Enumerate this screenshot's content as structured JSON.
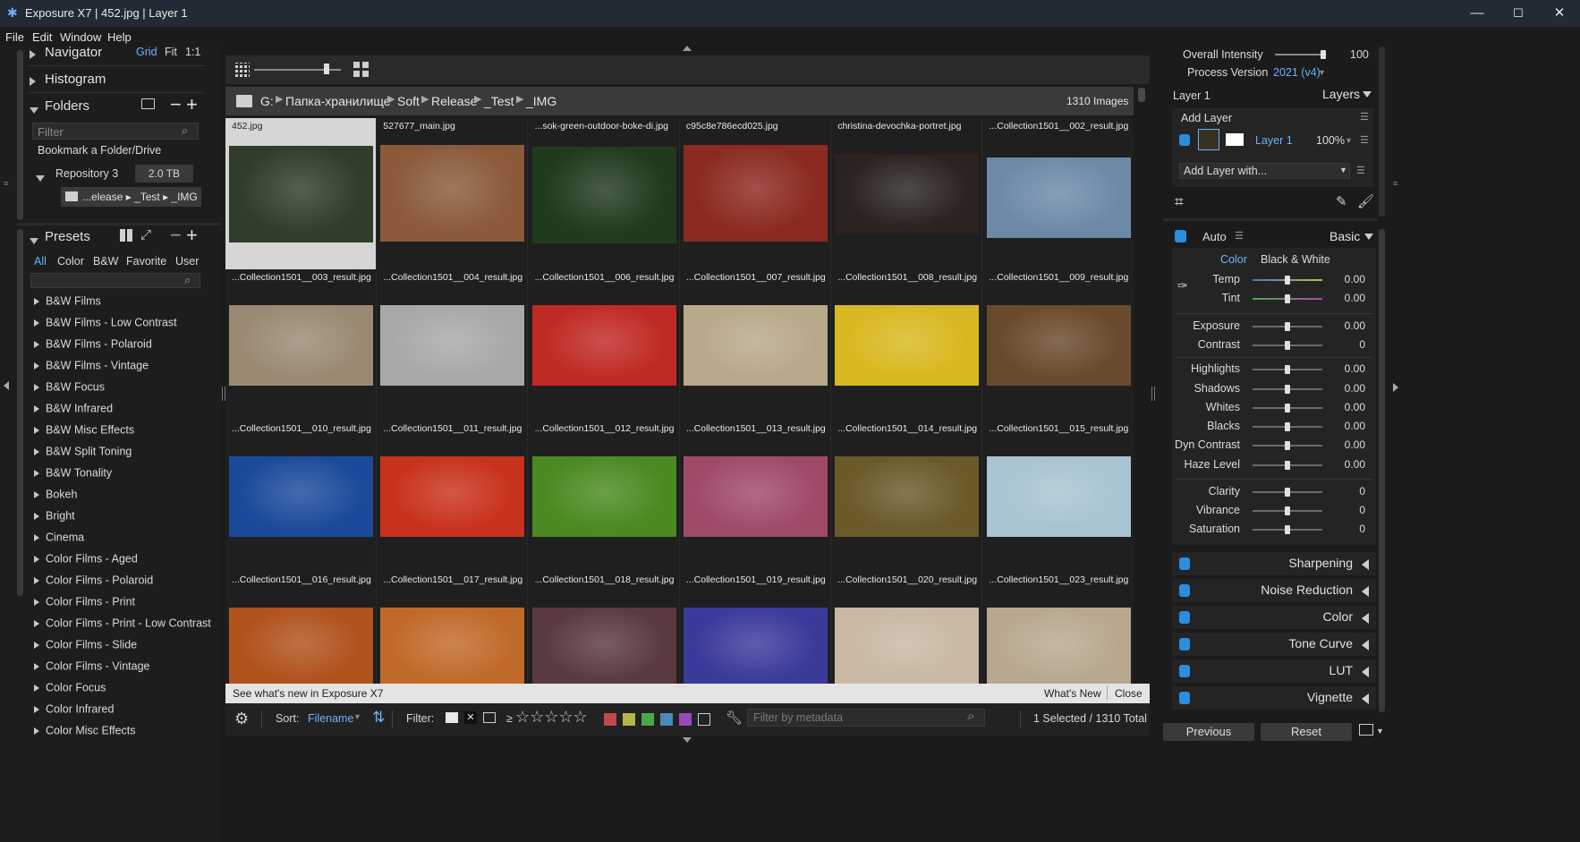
{
  "window": {
    "title": "Exposure X7 | 452.jpg | Layer 1"
  },
  "menu": [
    "File",
    "Edit",
    "Window",
    "Help"
  ],
  "left": {
    "navigator": "Navigator",
    "nav_modes": [
      "Grid",
      "Fit",
      "1:1"
    ],
    "histogram": "Histogram",
    "folders": "Folders",
    "folders_filter_placeholder": "Filter",
    "bookmark": "Bookmark a Folder/Drive",
    "repository": "Repository 3",
    "repository_size": "2.0 TB",
    "current_folder": "...elease ▸ _Test ▸ _IMG",
    "presets": "Presets",
    "preset_tabs": [
      "All",
      "Color",
      "B&W",
      "Favorite",
      "User"
    ],
    "preset_items": [
      "B&W Films",
      "B&W Films - Low Contrast",
      "B&W Films - Polaroid",
      "B&W Films - Vintage",
      "B&W Focus",
      "B&W Infrared",
      "B&W Misc Effects",
      "B&W Split Toning",
      "B&W Tonality",
      "Bokeh",
      "Bright",
      "Cinema",
      "Color Films - Aged",
      "Color Films - Polaroid",
      "Color Films - Print",
      "Color Films - Print - Low Contrast",
      "Color Films - Slide",
      "Color Films - Vintage",
      "Color Focus",
      "Color Infrared",
      "Color Misc Effects"
    ]
  },
  "center": {
    "path_drive": "G:",
    "path": [
      "Папка-хранилище",
      "Soft",
      "Release",
      "_Test",
      "_IMG"
    ],
    "image_count": "1310 Images",
    "images": [
      {
        "name": "452.jpg",
        "color": "#2f3d2a"
      },
      {
        "name": "527677_main.jpg",
        "color": "#8a5a3a"
      },
      {
        "name": "...sok-green-outdoor-boke-di.jpg",
        "color": "#1f3a1c"
      },
      {
        "name": "c95c8e786ecd025.jpg",
        "color": "#8a2a20"
      },
      {
        "name": "christina-devochka-portret.jpg",
        "color": "#2a2320"
      },
      {
        "name": "...Collection1501__002_result.jpg",
        "color": "#6c8aa8"
      },
      {
        "name": "...Collection1501__003_result.jpg",
        "color": "#9a8a74"
      },
      {
        "name": "...Collection1501__004_result.jpg",
        "color": "#a8a8a8"
      },
      {
        "name": "...Collection1501__006_result.jpg",
        "color": "#c02a24"
      },
      {
        "name": "...Collection1501__007_result.jpg",
        "color": "#b8a88a"
      },
      {
        "name": "...Collection1501__008_result.jpg",
        "color": "#d8b820"
      },
      {
        "name": "...Collection1501__009_result.jpg",
        "color": "#6a4a2c"
      },
      {
        "name": "...Collection1501__010_result.jpg",
        "color": "#1c4a9a"
      },
      {
        "name": "...Collection1501__011_result.jpg",
        "color": "#c8321c"
      },
      {
        "name": "...Collection1501__012_result.jpg",
        "color": "#4a8a20"
      },
      {
        "name": "...Collection1501__013_result.jpg",
        "color": "#a04a6a"
      },
      {
        "name": "...Collection1501__014_result.jpg",
        "color": "#6a5a2a"
      },
      {
        "name": "...Collection1501__015_result.jpg",
        "color": "#a8c4d0"
      },
      {
        "name": "...Collection1501__016_result.jpg",
        "color": "#b0521c"
      },
      {
        "name": "...Collection1501__017_result.jpg",
        "color": "#c06a2a"
      },
      {
        "name": "...Collection1501__018_result.jpg",
        "color": "#5a3a40"
      },
      {
        "name": "...Collection1501__019_result.jpg",
        "color": "#3a3a9a"
      },
      {
        "name": "...Collection1501__020_result.jpg",
        "color": "#c8b8a4"
      },
      {
        "name": "...Collection1501__023_result.jpg",
        "color": "#b8a890"
      }
    ],
    "notice": "See what's new in Exposure X7",
    "whats_new": "What's New",
    "close": "Close",
    "sort_label": "Sort:",
    "sort_value": "Filename",
    "filter_label": "Filter:",
    "rating_prefix": "≥",
    "stars": "☆☆☆☆☆",
    "color_labels": [
      "#c0494a",
      "#b5b54a",
      "#4aa84a",
      "#4a8ab8",
      "#9a4ab8"
    ],
    "metadata_placeholder": "Filter by metadata",
    "selection_status": "1 Selected / 1310 Total"
  },
  "right": {
    "overall_intensity_label": "Overall Intensity",
    "overall_intensity_value": "100",
    "process_version_label": "Process Version",
    "process_version_value": "2021 (v4)",
    "layer_name": "Layer 1",
    "layers_title": "Layers",
    "add_layer": "Add Layer",
    "layer_row_name": "Layer 1",
    "layer_opacity": "100%",
    "add_layer_with": "Add Layer with...",
    "auto": "Auto",
    "basic": "Basic",
    "mode_color": "Color",
    "mode_bw": "Black & White",
    "sliders": [
      {
        "label": "Temp",
        "value": "0.00"
      },
      {
        "label": "Tint",
        "value": "0.00"
      },
      {
        "label": "Exposure",
        "value": "0.00"
      },
      {
        "label": "Contrast",
        "value": "0"
      },
      {
        "label": "Highlights",
        "value": "0.00"
      },
      {
        "label": "Shadows",
        "value": "0.00"
      },
      {
        "label": "Whites",
        "value": "0.00"
      },
      {
        "label": "Blacks",
        "value": "0.00"
      },
      {
        "label": "Dyn Contrast",
        "value": "0.00"
      },
      {
        "label": "Haze Level",
        "value": "0.00"
      },
      {
        "label": "Clarity",
        "value": "0"
      },
      {
        "label": "Vibrance",
        "value": "0"
      },
      {
        "label": "Saturation",
        "value": "0"
      }
    ],
    "sections": [
      "Sharpening",
      "Noise Reduction",
      "Color",
      "Tone Curve",
      "LUT",
      "Vignette"
    ],
    "previous": "Previous",
    "reset": "Reset"
  }
}
